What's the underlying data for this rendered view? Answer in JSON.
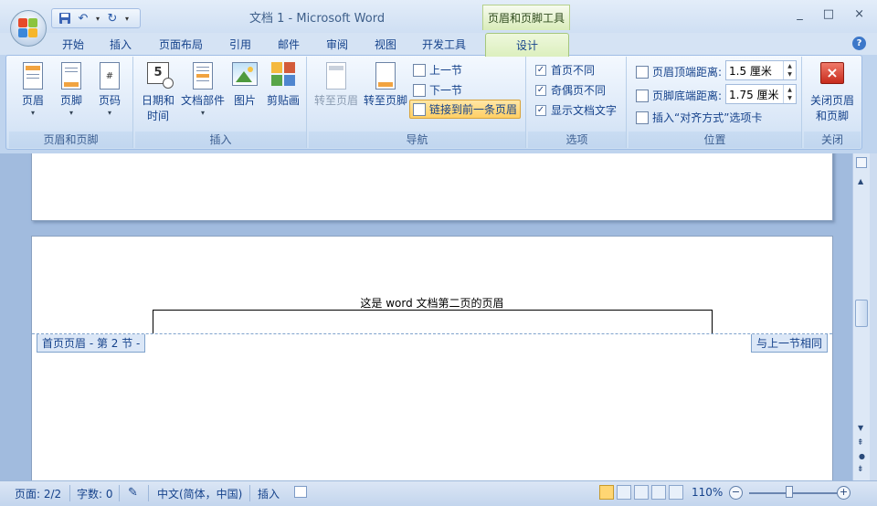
{
  "window": {
    "title": "文档 1 - Microsoft Word",
    "context_tab_title": "页眉和页脚工具",
    "controls": [
      "_",
      "□",
      "×"
    ]
  },
  "tabs": [
    "开始",
    "插入",
    "页面布局",
    "引用",
    "邮件",
    "审阅",
    "视图",
    "开发工具"
  ],
  "active_tab": "设计",
  "ribbon": {
    "group_header_footer": {
      "label": "页眉和页脚",
      "buttons": [
        "页眉",
        "页脚",
        "页码"
      ]
    },
    "group_insert": {
      "label": "插入",
      "datetime_line1": "日期和",
      "datetime_line2": "时间",
      "parts": "文档部件",
      "picture": "图片",
      "clipart": "剪贴画"
    },
    "group_nav": {
      "label": "导航",
      "goto_header": "转至页眉",
      "goto_footer": "转至页脚",
      "prev_section": "上一节",
      "next_section": "下一节",
      "link_previous": "链接到前一条页眉"
    },
    "group_options": {
      "label": "选项",
      "first_page": "首页不同",
      "odd_even": "奇偶页不同",
      "show_text": "显示文档文字"
    },
    "group_position": {
      "label": "位置",
      "header_top_label": "页眉顶端距离:",
      "header_top_value": "1.5 厘米",
      "footer_bottom_label": "页脚底端距离:",
      "footer_bottom_value": "1.75 厘米",
      "insert_align_tab": "插入“对齐方式”选项卡"
    },
    "group_close": {
      "label": "关闭",
      "close_line1": "关闭页眉",
      "close_line2": "和页脚"
    }
  },
  "document": {
    "header_text": "这是 word 文档第二页的页眉",
    "header_label_left": "首页页眉 - 第 2 节 -",
    "header_label_right": "与上一节相同"
  },
  "statusbar": {
    "page": "页面: 2/2",
    "words": "字数: 0",
    "language": "中文(简体，中国)",
    "mode": "插入",
    "zoom": "110%"
  },
  "colors": {
    "ribbon_bg": "#dae7f7",
    "context_green": "#dcefbe",
    "workspace": "#a1bbde",
    "text_blue": "#15428b"
  }
}
